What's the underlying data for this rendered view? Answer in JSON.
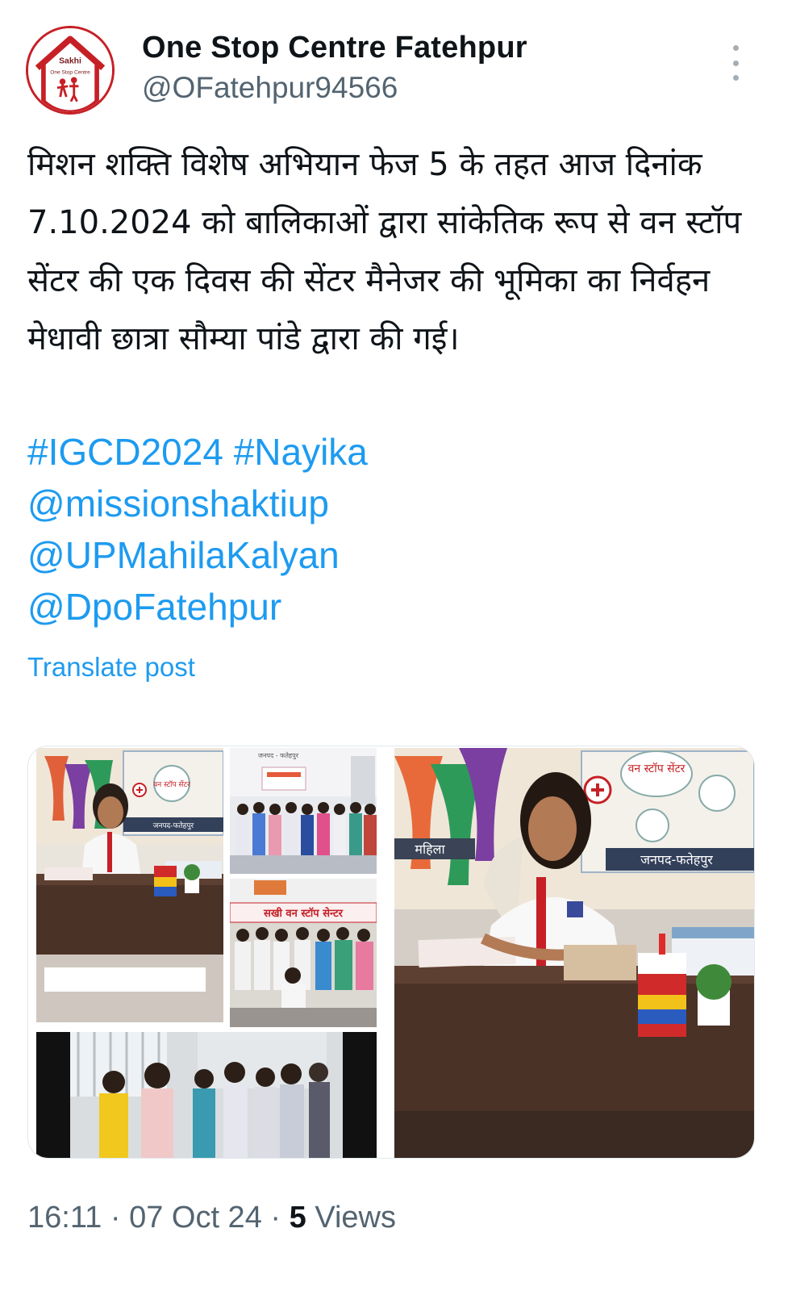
{
  "account": {
    "name": "One Stop Centre Fatehpur",
    "handle": "@OFatehpur94566",
    "avatar_text_top": "Sakhi",
    "avatar_text_bottom": "One Stop Centre"
  },
  "post": {
    "text": "मिशन शक्ति विशेष अभियान फेज 5 के तहत आज दिनांक 7.10.2024 को बालिकाओं द्वारा सांकेतिक रूप से वन स्टॉप सेंटर की एक दिवस की सेंटर मैनेजर की भूमिका का निर्वहन  मेधावी छात्रा सौम्या पांडे द्वारा की गई।",
    "hashtags": [
      "#IGCD2024",
      "#Nayika"
    ],
    "mentions": [
      "@missionshaktiup",
      "@UPMahilaKalyan",
      "@DpoFatehpur"
    ],
    "translate_label": "Translate post"
  },
  "media": {
    "poster_text_1": "वन स्टॉप सेंटर",
    "poster_text_2": "जनपद-फतेहपुर",
    "poster_text_3": "महिला",
    "banner_text": "सखी वन स्टॉप सेन्टर",
    "top_sign_text": "जनपद - फतेहपुर"
  },
  "meta": {
    "time": "16:11",
    "date": "07 Oct 24",
    "views_count": "5",
    "views_label": "Views",
    "separator": "·"
  },
  "colors": {
    "link": "#1d9bf0",
    "text": "#0f1419",
    "secondary": "#536471",
    "brand_red": "#c62026"
  },
  "icons": {
    "more": "more-vertical-icon"
  }
}
